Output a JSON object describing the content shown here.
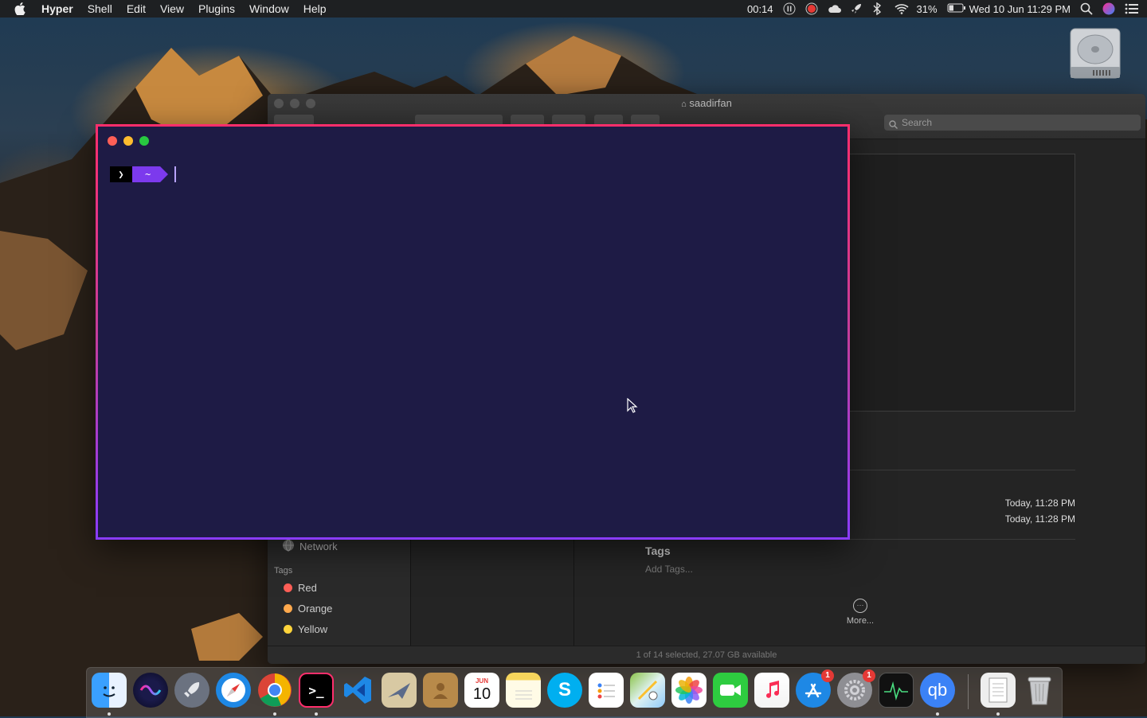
{
  "menubar": {
    "apple_icon": "apple-icon",
    "app_name": "Hyper",
    "items": [
      "Shell",
      "Edit",
      "View",
      "Plugins",
      "Window",
      "Help"
    ],
    "timer": "00:14",
    "battery_percent": "31%",
    "datetime": "Wed 10 Jun  11:29 PM"
  },
  "finder": {
    "title": "saadirfan",
    "search_placeholder": "Search",
    "sidebar": {
      "network_label": "Network",
      "tags_heading": "Tags",
      "tags": [
        {
          "label": "Red",
          "color": "#ff5f57"
        },
        {
          "label": "Orange",
          "color": "#ffa94d"
        },
        {
          "label": "Yellow",
          "color": "#ffd43b"
        }
      ]
    },
    "info": {
      "created": "Today, 11:28 PM",
      "modified": "Today, 11:28 PM",
      "tags_heading": "Tags",
      "tags_placeholder": "Add Tags...",
      "more_label": "More..."
    },
    "status": "1 of 14 selected, 27.07 GB available"
  },
  "hyper": {
    "prompt_symbol": "❯",
    "path": "~",
    "accent": "#7c3aed",
    "background": "#1e1b45"
  },
  "dock": {
    "apps": [
      "Finder",
      "Siri",
      "Launchpad",
      "Safari",
      "Chrome",
      "Hyper",
      "VS Code",
      "Mail",
      "Contacts",
      "Calendar",
      "Notes",
      "Skype",
      "Reminders",
      "Maps",
      "Photos",
      "FaceTime",
      "Music",
      "App Store",
      "System Preferences",
      "Activity Monitor",
      "qBittorrent"
    ],
    "calendar_month": "JUN",
    "calendar_day": "10",
    "appstore_badge": "1",
    "sysprefs_badge": "1",
    "qb_label": "qb"
  }
}
